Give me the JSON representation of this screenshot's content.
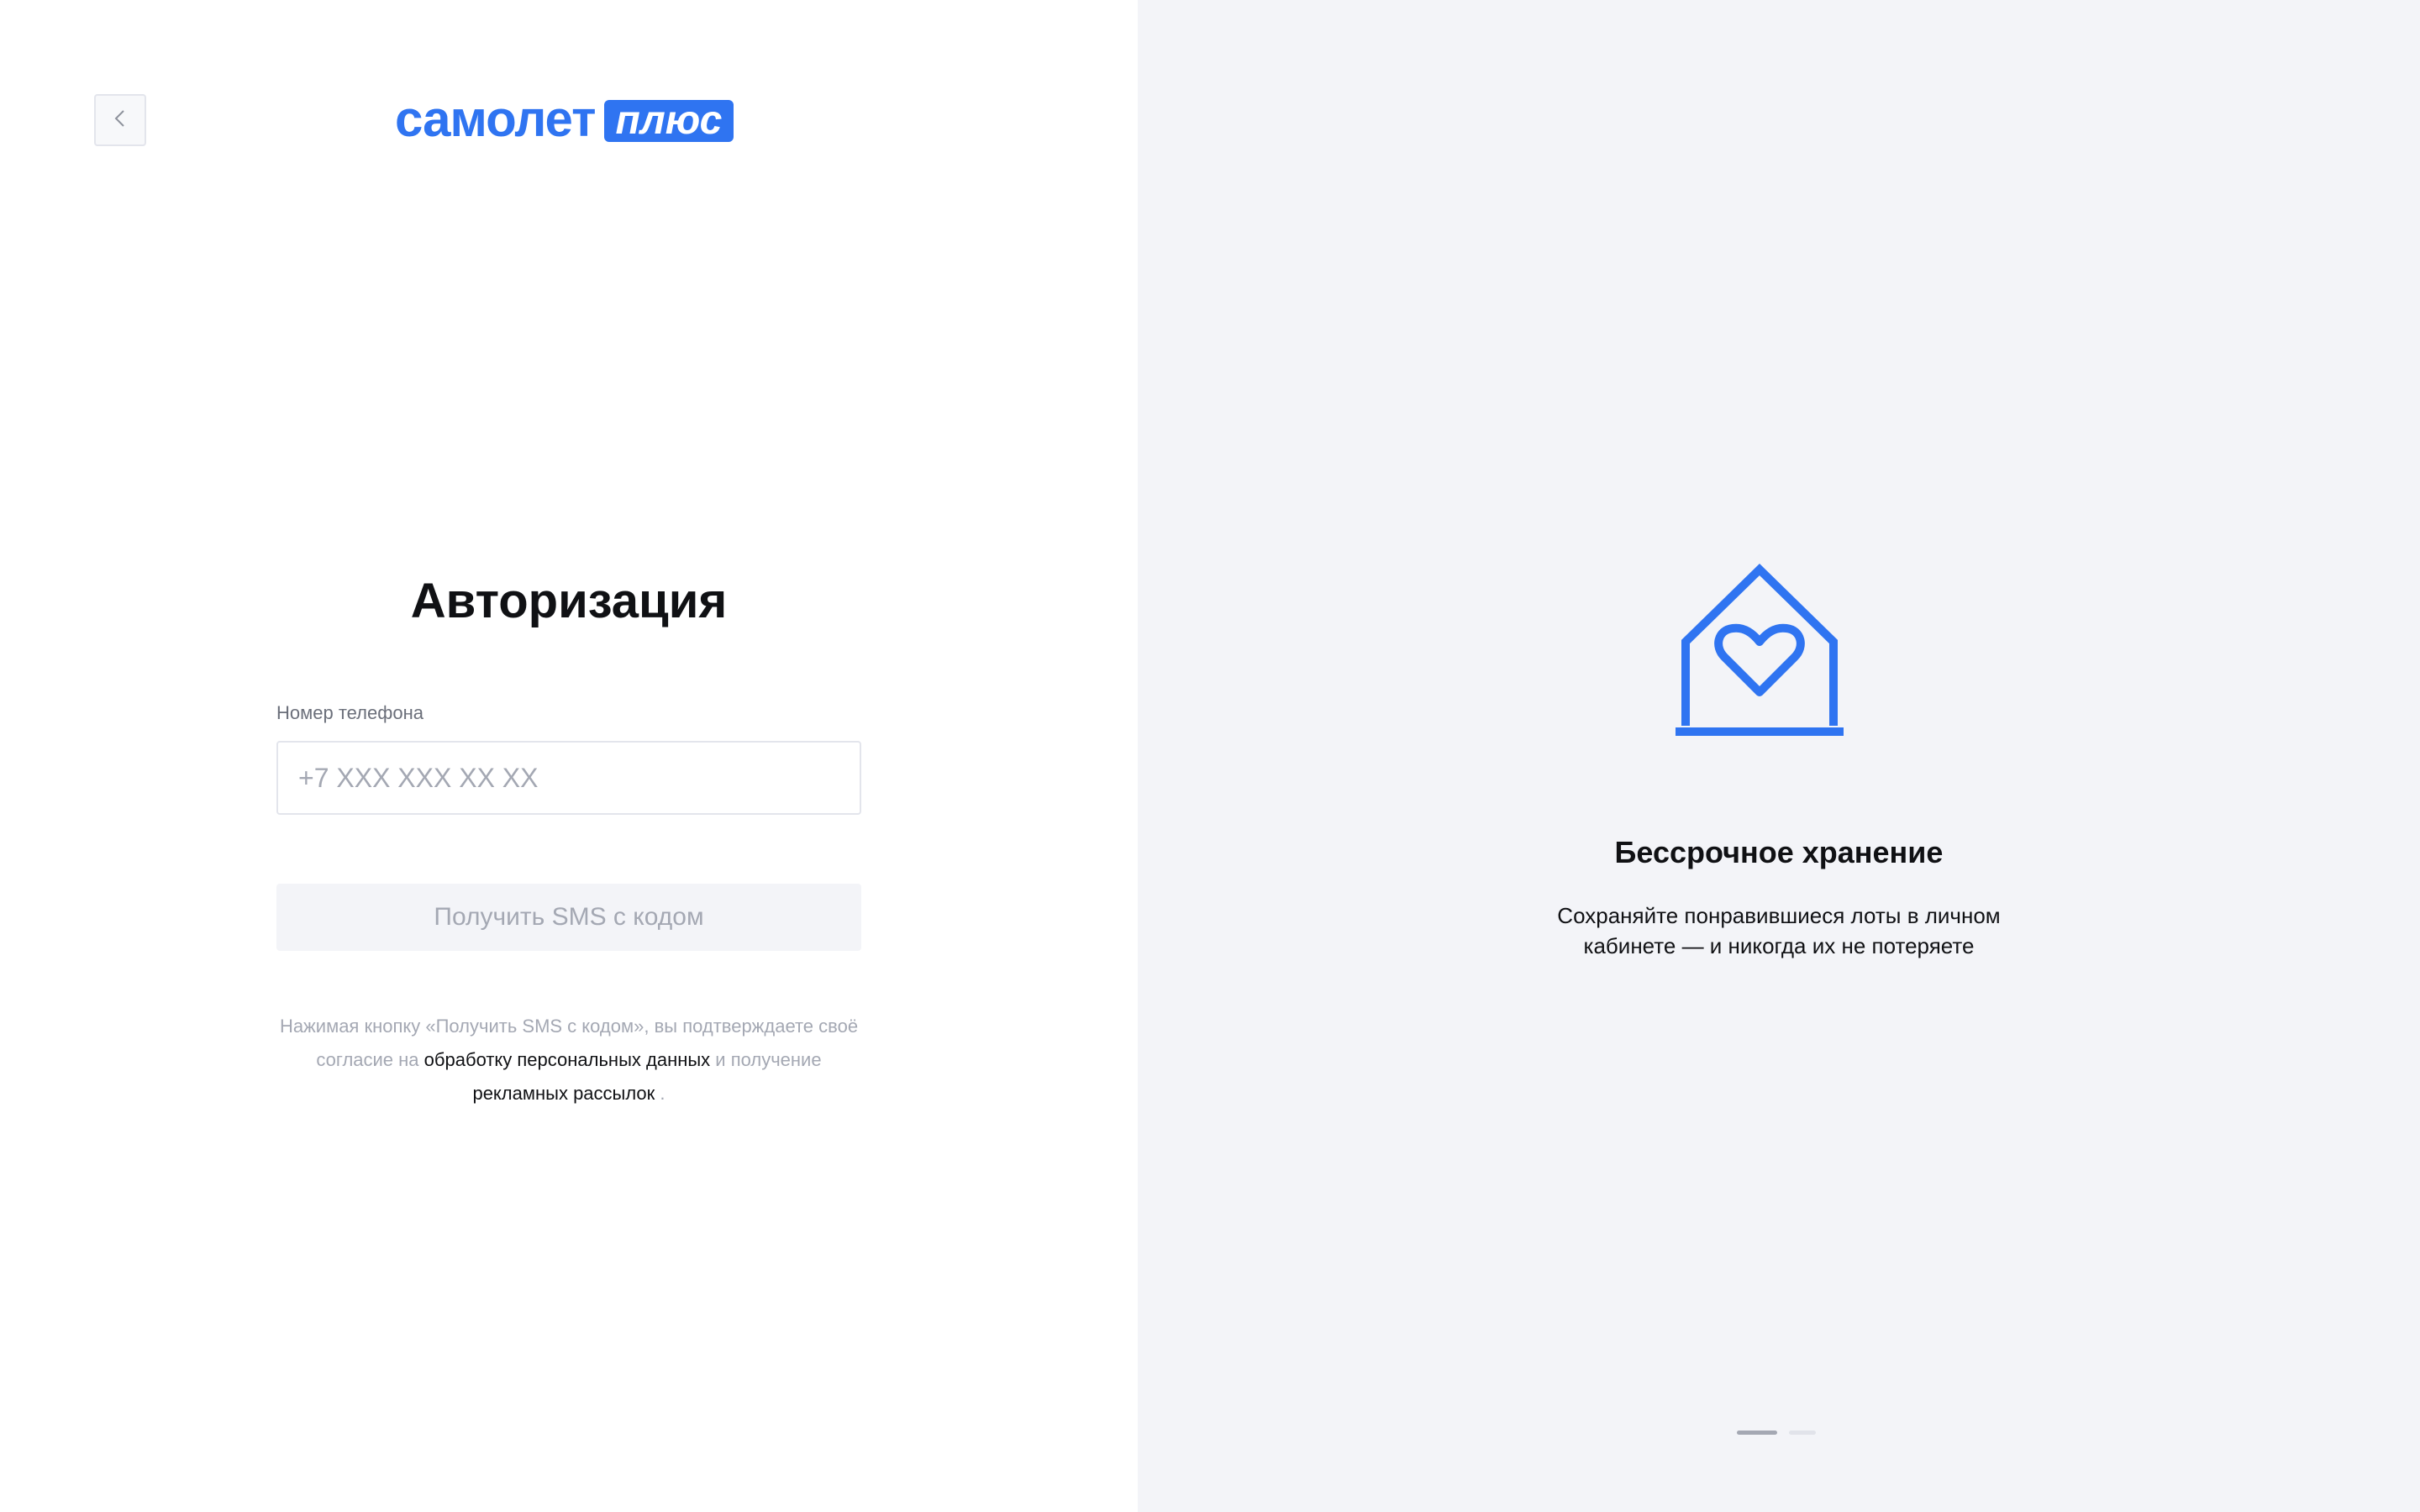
{
  "header": {
    "back_icon": "chevron-left-icon",
    "logo": {
      "word": "самолет",
      "badge": "плюс",
      "color": "#2f74f1"
    }
  },
  "form": {
    "title": "Авторизация",
    "phone": {
      "label": "Номер телефона",
      "placeholder": "+7 XXX XXX XX XX",
      "value": ""
    },
    "submit_label": "Получить SMS с кодом",
    "consent": {
      "prefix": "Нажимая кнопку «Получить SMS с кодом», вы подтверждаете своё согласие на ",
      "link_personal_data": "обработку персональных данных",
      "middle": " и получение ",
      "link_ads": "рекламных рассылок",
      "suffix": " ."
    }
  },
  "promo": {
    "icon": "house-heart-icon",
    "title": "Бессрочное хранение",
    "text": "Сохраняйте понравившиеся лоты в личном кабинете — и никогда их не потеряете",
    "slides_count": 2,
    "active_slide": 1
  },
  "colors": {
    "accent": "#2f74f1",
    "right_panel_bg": "#f3f4f8",
    "muted_text": "#a4a8b3"
  }
}
